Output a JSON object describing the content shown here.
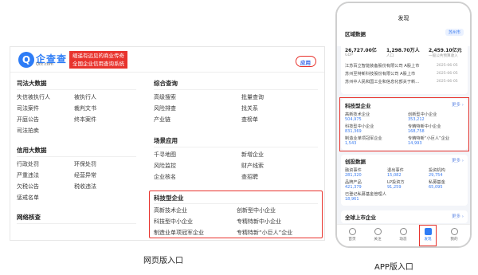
{
  "web": {
    "logo_text": "企查查",
    "logo_sub": "Qcc.com",
    "slogan_line1": "缅遥有远见的商业传奇",
    "slogan_line2": "全国企业信用查询系统",
    "app_button": "应用",
    "sections": {
      "judicial": {
        "title": "司法大数据",
        "items": [
          "失信被执行人",
          "被执行人",
          "司法案件",
          "裁判文书",
          "开庭公告",
          "终本案件",
          "司法拍卖"
        ]
      },
      "credit": {
        "title": "信用大数据",
        "items": [
          "行政处罚",
          "环保处罚",
          "严重违法",
          "经营异常",
          "欠税公告",
          "税收违法",
          "惩戒名单"
        ]
      },
      "network": {
        "title": "网络核查"
      },
      "composite": {
        "title": "综合查询",
        "items": [
          "高级搜索",
          "批量查询",
          "风险排查",
          "找关系",
          "产业链",
          "查榜单"
        ]
      },
      "scene": {
        "title": "场景应用",
        "items": [
          "千寻地图",
          "新增企业",
          "风险监控",
          "财产线索",
          "企业核名",
          "查招聘"
        ]
      },
      "tech": {
        "title": "科技型企业",
        "items": [
          "高新技术企业",
          "创新型中小企业",
          "科技型中小企业",
          "专精特新中小企业",
          "制造业单项冠军企业",
          "专精特新“小巨人”企业"
        ]
      }
    },
    "caption": "网页版入口"
  },
  "app": {
    "title": "发现",
    "region": {
      "title": "区域数据",
      "city": "苏州市",
      "stats": [
        {
          "value": "26,727.00亿",
          "label": "GDP"
        },
        {
          "value": "1,298.70万人",
          "label": "人口"
        },
        {
          "value": "2,459.10亿元",
          "label": "一般公共预算收入"
        }
      ],
      "news": [
        {
          "text": "江苏百立智能装备股份有限公司 A股上市",
          "date": "2025-06-05"
        },
        {
          "text": "苏州至特新科技股份有限公司 A股上市",
          "date": "2025-06-05"
        },
        {
          "text": "苏州中人民和国工业和信息化部关于新...",
          "date": "2025-06-05"
        }
      ]
    },
    "tech": {
      "title": "科技型企业",
      "more": "更多 ›",
      "items": [
        {
          "name": "高新技术企业",
          "count": "504,975"
        },
        {
          "name": "创新型中小企业",
          "count": "353,212"
        },
        {
          "name": "科技型中小企业",
          "count": "831,369"
        },
        {
          "name": "专精特新中小企业",
          "count": "168,758"
        },
        {
          "name": "制造业单项冠军企业",
          "count": "1,543"
        },
        {
          "name": "专精特新“小巨人”企业",
          "count": "14,993"
        }
      ]
    },
    "venture": {
      "title": "创投数据",
      "more": "更多 ›",
      "items": [
        {
          "name": "融资事件",
          "count": "281,320"
        },
        {
          "name": "退出事件",
          "count": "15,082"
        },
        {
          "name": "投资机构",
          "count": "29,754"
        },
        {
          "name": "品牌产品",
          "count": "421,379"
        },
        {
          "name": "LP投资方",
          "count": "91,259"
        },
        {
          "name": "私募基金",
          "count": "65,095"
        }
      ],
      "extra": "已登记私募基金管理人",
      "extra_count": "18,961"
    },
    "listed": {
      "title": "全球上市企业",
      "more": "更多 ›"
    },
    "nav": [
      "首页",
      "关注",
      "动态",
      "发现",
      "我的"
    ],
    "caption": "APP版入口"
  },
  "colors": {
    "accent": "#2d7cf6",
    "highlight": "#e8332d"
  }
}
